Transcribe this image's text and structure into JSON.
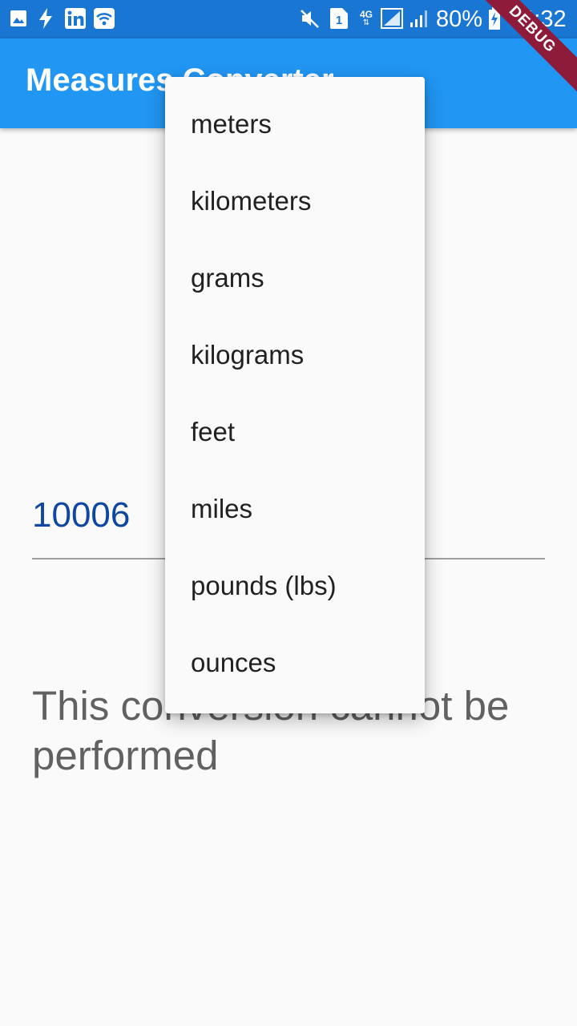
{
  "status_bar": {
    "battery": "80%",
    "time": "04:32",
    "sim_label": "1",
    "network": "4G",
    "icons": [
      "gallery-icon",
      "bolt-icon",
      "linkedin-icon",
      "wifi-icon",
      "mute-icon",
      "sim-icon",
      "network-4g-icon",
      "signal-icon",
      "cell-signal-icon",
      "battery-charging-icon"
    ]
  },
  "app_bar": {
    "title": "Measures Converter"
  },
  "debug_banner": "DEBUG",
  "input": {
    "value": "10006"
  },
  "result": {
    "message": "This conversion cannot be performed"
  },
  "dropdown": {
    "items": [
      "meters",
      "kilometers",
      "grams",
      "kilograms",
      "feet",
      "miles",
      "pounds (lbs)",
      "ounces"
    ]
  },
  "colors": {
    "status_bar": "#1976D2",
    "app_bar": "#2196F3",
    "input_text": "#0D47A1",
    "result_text": "#616161"
  }
}
